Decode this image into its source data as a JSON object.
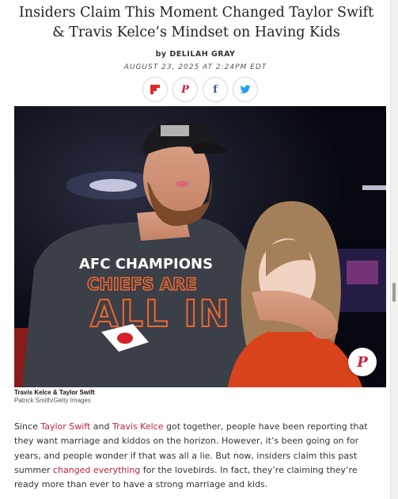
{
  "article": {
    "headline": "Insiders Claim This Moment Changed Taylor Swift & Travis Kelce’s Mindset on Having Kids",
    "byline_prefix": "by",
    "author": "DELILAH GRAY",
    "date": "AUGUST 23, 2025 AT 2:24PM EDT"
  },
  "share": {
    "icons": [
      "flipboard-icon",
      "pinterest-icon",
      "facebook-icon",
      "twitter-icon"
    ],
    "colors": {
      "flipboard": "#e12828",
      "pinterest": "#c8203d",
      "facebook": "#3b5998",
      "twitter": "#1da1f2"
    }
  },
  "image": {
    "shirt_line1": "AFC CHAMPIONS",
    "shirt_line2": "CHIEFS ARE",
    "shirt_line3": "ALL IN",
    "caption_title": "Travis Kelce & Taylor Swift",
    "caption_credit": "Patrick Smith/Getty Images"
  },
  "body": {
    "s1": "Since ",
    "link1": "Taylor Swift",
    "s2": " and ",
    "link2": "Travis Kelce",
    "s3": " got together, people have been reporting that they want marriage and kiddos on the horizon. However, it’s been going on for years, and people wonder if that was all a lie. But now, insiders claim this past summer ",
    "link3": "changed everything",
    "s4": " for the lovebirds. In fact, they’re claiming they’re ready more than ever to have a strong marriage and kids."
  },
  "colors": {
    "link": "#c8203d",
    "shirt_text": "#f0672c"
  }
}
